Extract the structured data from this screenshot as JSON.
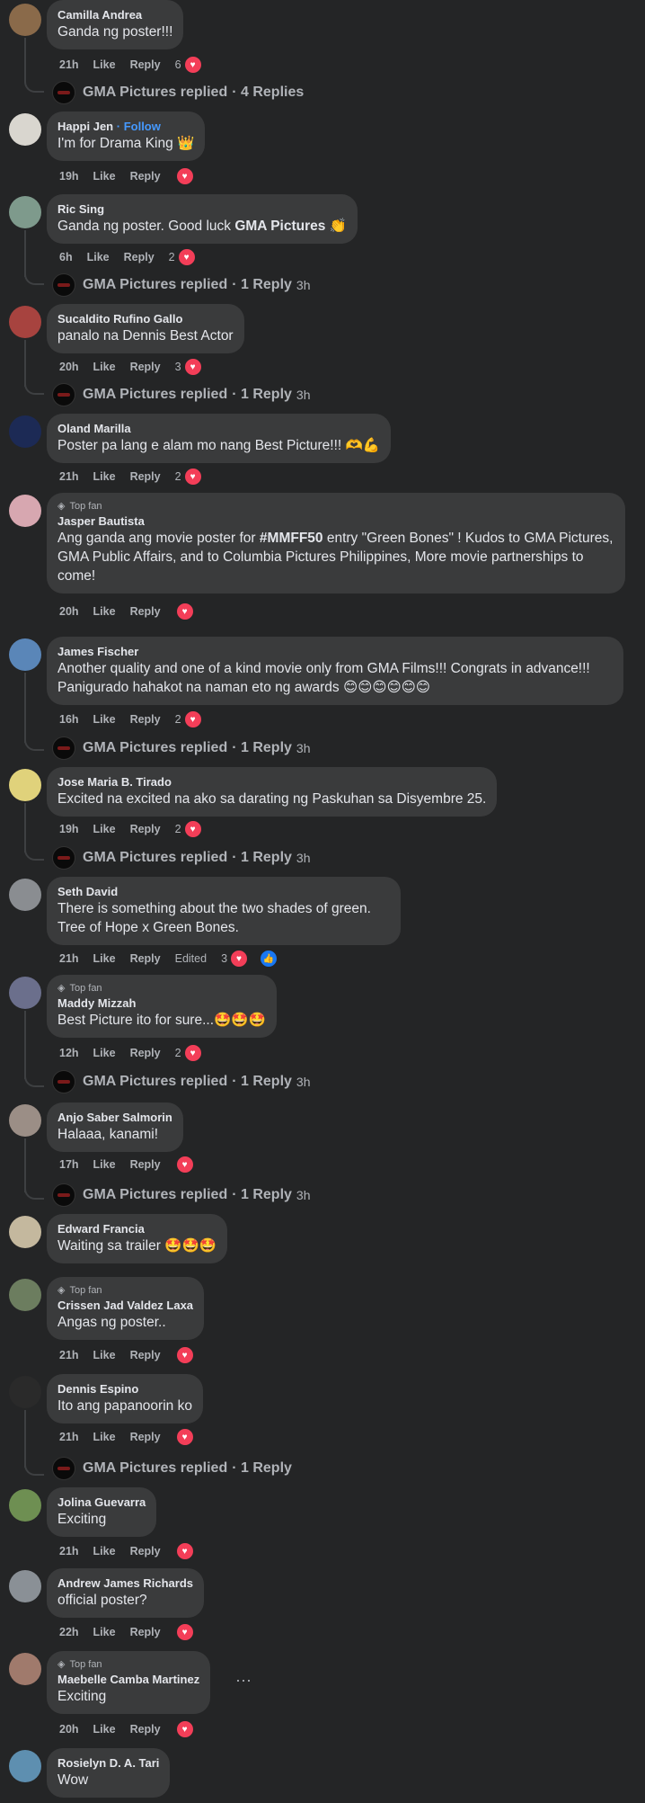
{
  "labels": {
    "like": "Like",
    "reply": "Reply",
    "edited": "Edited",
    "top_fan": "Top fan",
    "follow": "Follow",
    "more": "···"
  },
  "comments": [
    {
      "name": "Camilla Andrea",
      "text": "Ganda ng poster!!!",
      "time": "21h",
      "count": "6",
      "replied": {
        "by": "GMA Pictures replied",
        "meta": "· 4 Replies",
        "time": ""
      }
    },
    {
      "name": "Happi Jen",
      "text": "I'm for Drama King 👑",
      "time": "19h",
      "count": ""
    },
    {
      "name": "Ric Sing",
      "text_pre": "Ganda ng poster. Good luck ",
      "text_bold": "GMA Pictures",
      "text_post": " 👏",
      "time": "6h",
      "count": "2",
      "replied": {
        "by": "GMA Pictures replied",
        "meta": "· 1 Reply",
        "time": "3h"
      }
    },
    {
      "name": "Sucaldito Rufino Gallo",
      "text": "panalo na Dennis Best Actor",
      "time": "20h",
      "count": "3",
      "replied": {
        "by": "GMA Pictures replied",
        "meta": "· 1 Reply",
        "time": "3h"
      }
    },
    {
      "name": "Oland Marilla",
      "text": "Poster pa lang e alam mo nang Best Picture!!! 🫶💪",
      "time": "21h",
      "count": "2"
    },
    {
      "name": "Jasper Bautista",
      "top_fan": true,
      "text_pre": "Ang ganda ang movie poster for ",
      "text_bold": "#MMFF50",
      "text_post": " entry \"Green Bones\" ! Kudos to GMA Pictures, GMA Public Affairs, and to Columbia Pictures Philippines, More movie partnerships to come!",
      "time": "20h",
      "count": ""
    },
    {
      "name": "James Fischer",
      "text": "Another quality and one of a kind movie only from GMA Films!!! Congrats in advance!!! Panigurado hahakot na naman eto ng awards 😊😊😊😊😊😊",
      "time": "16h",
      "count": "2",
      "replied": {
        "by": "GMA Pictures replied",
        "meta": "· 1 Reply",
        "time": "3h"
      }
    },
    {
      "name": "Jose Maria B. Tirado",
      "text": "Excited na excited na ako sa darating ng Paskuhan sa Disyembre 25.",
      "time": "19h",
      "count": "2",
      "replied": {
        "by": "GMA Pictures replied",
        "meta": "· 1 Reply",
        "time": "3h"
      }
    },
    {
      "name": "Seth David",
      "text": "There is something about the two shades of green. Tree of Hope x Green Bones.",
      "time": "21h",
      "count": "3",
      "edited": true
    },
    {
      "name": "Maddy Mizzah",
      "top_fan": true,
      "text": "Best Picture ito for sure...🤩🤩🤩",
      "time": "12h",
      "count": "2",
      "replied": {
        "by": "GMA Pictures replied",
        "meta": "· 1 Reply",
        "time": "3h"
      }
    },
    {
      "name": "Anjo Saber Salmorin",
      "text": "Halaaa, kanami!",
      "time": "17h",
      "count": "",
      "replied": {
        "by": "GMA Pictures replied",
        "meta": "· 1 Reply",
        "time": "3h"
      }
    },
    {
      "name": "Edward Francia",
      "text": "Waiting sa trailer 🤩🤩🤩",
      "time": "",
      "count": ""
    },
    {
      "name": "Crissen Jad Valdez Laxa",
      "top_fan": true,
      "text": "Angas ng poster..",
      "time": "21h",
      "count": ""
    },
    {
      "name": "Dennis Espino",
      "text": "Ito ang papanoorin ko",
      "time": "21h",
      "count": "",
      "replied": {
        "by": "GMA Pictures replied",
        "meta": "· 1 Reply",
        "time": ""
      }
    },
    {
      "name": "Jolina Guevarra",
      "text": "Exciting",
      "time": "21h",
      "count": ""
    },
    {
      "name": "Andrew James Richards",
      "text": "official poster?",
      "time": "22h",
      "count": ""
    },
    {
      "name": "Maebelle Camba Martinez",
      "top_fan": true,
      "text": "Exciting",
      "time": "20h",
      "count": ""
    },
    {
      "name": "Rosielyn D. A. Tari",
      "text": "Wow",
      "time": "",
      "count": ""
    }
  ],
  "avatar_colors": [
    "#8a6a4a",
    "#d9d6cf",
    "#7e9a8c",
    "#a7433f",
    "#1c2a55",
    "#d7a7b0",
    "#5a86b8",
    "#e0d27b",
    "#8a8d91",
    "#6b6f8c",
    "#9b8e86",
    "#c4b89e",
    "#6c7d5f",
    "#2a2a2a",
    "#6e8f52",
    "#8a9096",
    "#a07a6c",
    "#5e8fb0"
  ],
  "heart_icon": "heart-icon",
  "like_icon": "thumbs-up-icon",
  "accent": "#4599ff",
  "reaction_red": "#f33e58"
}
